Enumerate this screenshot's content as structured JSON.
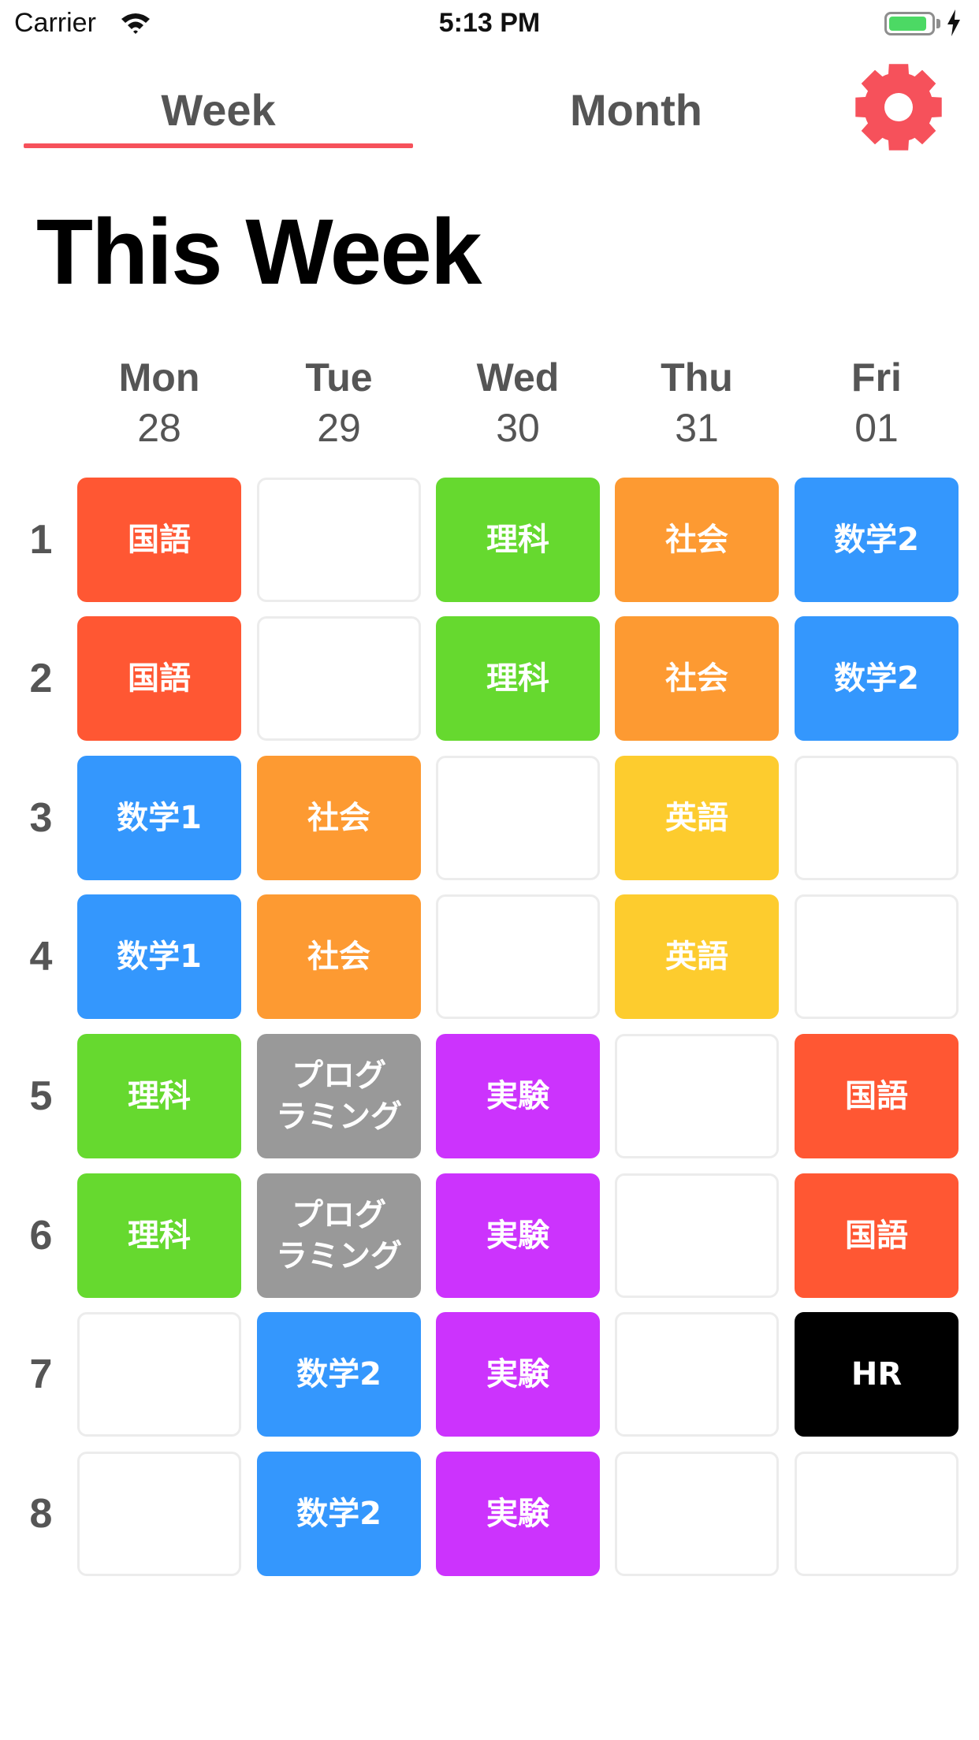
{
  "status_bar": {
    "carrier": "Carrier",
    "time": "5:13 PM",
    "battery_level": 0.9,
    "battery_color": "#4cd964"
  },
  "tabs": [
    {
      "label": "Week",
      "selected": true
    },
    {
      "label": "Month",
      "selected": false
    }
  ],
  "accent_color": "#f6515b",
  "settings_icon": "gear-icon",
  "page_title": "This Week",
  "days": [
    {
      "name": "Mon",
      "date": "28"
    },
    {
      "name": "Tue",
      "date": "29"
    },
    {
      "name": "Wed",
      "date": "30"
    },
    {
      "name": "Thu",
      "date": "31"
    },
    {
      "name": "Fri",
      "date": "01"
    }
  ],
  "periods": [
    "1",
    "2",
    "3",
    "4",
    "5",
    "6",
    "7",
    "8"
  ],
  "subject_colors": {
    "国語": "#ff5733",
    "理科": "#66d92f",
    "社会": "#fd9a32",
    "数学2": "#3497fd",
    "数学1": "#3497fd",
    "英語": "#fdcc2e",
    "プログラミング": "#999999",
    "実験": "#cc33fd",
    "HR": "#000000"
  },
  "timetable": [
    [
      "国語",
      "",
      "理科",
      "社会",
      "数学2"
    ],
    [
      "国語",
      "",
      "理科",
      "社会",
      "数学2"
    ],
    [
      "数学1",
      "社会",
      "",
      "英語",
      ""
    ],
    [
      "数学1",
      "社会",
      "",
      "英語",
      ""
    ],
    [
      "理科",
      "プログ\nラミング",
      "実験",
      "",
      "国語"
    ],
    [
      "理科",
      "プログ\nラミング",
      "実験",
      "",
      "国語"
    ],
    [
      "",
      "数学2",
      "実験",
      "",
      "HR"
    ],
    [
      "",
      "数学2",
      "実験",
      "",
      ""
    ]
  ]
}
